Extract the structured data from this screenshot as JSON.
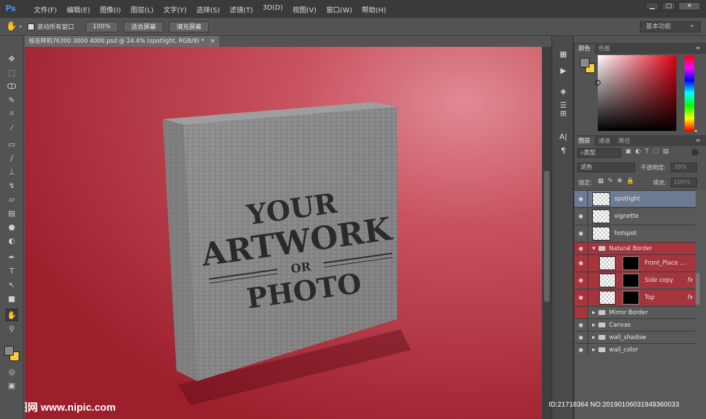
{
  "app": {
    "logo": "Ps"
  },
  "menubar": {
    "items": [
      "文件(F)",
      "编辑(E)",
      "图像(I)",
      "图层(L)",
      "文字(Y)",
      "选择(S)",
      "滤镜(T)",
      "3D(D)",
      "视图(V)",
      "窗口(W)",
      "帮助(H)"
    ]
  },
  "window_controls": {
    "minimize": "▁",
    "maximize": "□",
    "close": "✕"
  },
  "options": {
    "scroll_all": "滚动所有窗口",
    "zoom_100": "100%",
    "fit_screen": "适合屏幕",
    "fill_screen": "填充屏幕",
    "workspace": "基本功能"
  },
  "document": {
    "tab_title": "标志样机76300 3000 4000.psd @ 24.4% (spotlight, RGB/8) *",
    "close": "×"
  },
  "artwork": {
    "line1": "YOUR",
    "line2": "ARTWORK",
    "line3": "OR",
    "line4": "PHOTO"
  },
  "color_panel": {
    "tabs": [
      "颜色",
      "色板"
    ],
    "fg_color": "#8a8a8a",
    "bg_color": "#f2d23c"
  },
  "layers_panel": {
    "tabs": [
      "图层",
      "通道",
      "路径"
    ],
    "filter": "类型",
    "blend_mode": "滤色",
    "opacity_label": "不透明度:",
    "opacity_value": "39%",
    "lock_label": "锁定:",
    "fill_label": "填充:",
    "fill_value": "100%",
    "layers": [
      {
        "name": "spotlight",
        "type": "layer",
        "selected": true
      },
      {
        "name": "vignette",
        "type": "layer"
      },
      {
        "name": "hotspot",
        "type": "layer"
      },
      {
        "name": "Natural Border",
        "type": "group-open"
      },
      {
        "name": "Front_Place ...",
        "type": "smart"
      },
      {
        "name": "Side copy",
        "type": "smart",
        "fx": "fx"
      },
      {
        "name": "Top",
        "type": "smart",
        "fx": "fx"
      },
      {
        "name": "Mirror Border",
        "type": "group"
      },
      {
        "name": "Canvas",
        "type": "group"
      },
      {
        "name": "wall_shadow",
        "type": "group"
      },
      {
        "name": "wall_color",
        "type": "group"
      }
    ]
  },
  "watermark": {
    "site": "昵图网 www.nipic.com",
    "id": "ID:21718364 NO:20190106031949360033"
  }
}
